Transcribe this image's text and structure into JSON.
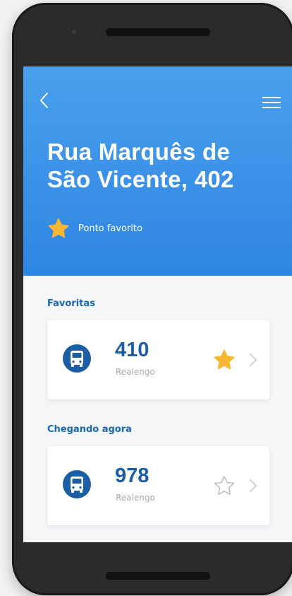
{
  "header": {
    "title_line1": "Rua Marquês de",
    "title_line2": "São Vicente, 402",
    "favorite_label": "Ponto favorito"
  },
  "sections": {
    "favorites_label": "Favoritas",
    "arriving_label": "Chegando agora"
  },
  "favorites": [
    {
      "line": "410",
      "destination": "Realengo",
      "favorited": true
    }
  ],
  "arriving": [
    {
      "line": "978",
      "destination": "Realengo",
      "favorited": false
    }
  ],
  "colors": {
    "header_blue": "#3a93e8",
    "line_blue": "#1b5ea6",
    "star_yellow": "#f7b731"
  },
  "icons": [
    "back-arrow-icon",
    "hamburger-menu-icon",
    "star-icon",
    "bus-icon",
    "chevron-right-icon"
  ]
}
